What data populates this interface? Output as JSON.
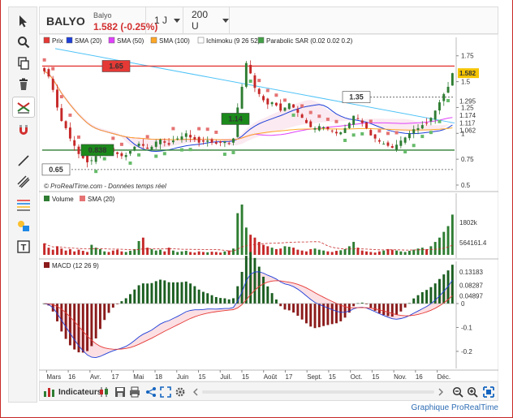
{
  "header": {
    "ticker": "BALYO",
    "company": "Balyo",
    "price_change": "1.582 (-0.25%)",
    "period": "1 J",
    "units": "200 U"
  },
  "legend": {
    "main": [
      "Prix",
      "SMA (20)",
      "SMA (50)",
      "SMA (100)",
      "Ichimoku (9 26 52)",
      "Parabolic SAR (0.02 0.02 0.2)"
    ],
    "main_colors": [
      "#e53935",
      "#1e3fd8",
      "#e040fb",
      "#ffa726",
      "#ffffff",
      "#43a047"
    ],
    "source": "© ProRealTime.com - Données temps réel",
    "volume": [
      "Volume",
      "SMA (20)"
    ],
    "macd": "MACD (12 26 9)"
  },
  "footer": {
    "link": "Graphique ProRealTime",
    "indicators": "Indicateurs"
  },
  "chart_data": [
    {
      "type": "candlestick",
      "title": "BALYO",
      "x_tick_labels": [
        "Mars",
        "16",
        "Avr.",
        "17",
        "Mai",
        "18",
        "Juin",
        "15",
        "Juil.",
        "15",
        "Août",
        "17",
        "Sept.",
        "15",
        "Oct.",
        "15",
        "Nov.",
        "16",
        "Déc."
      ],
      "y_tick_labels": [
        "1.75",
        "1.5",
        "1.25",
        "1",
        "0.75",
        "0.5"
      ],
      "ylim": [
        0.5,
        1.85
      ],
      "last_price": 1.582,
      "price_labels": [
        {
          "text": "1.65",
          "value": 1.65
        },
        {
          "text": "1.35",
          "value": 1.35
        },
        {
          "text": "1.14",
          "value": 1.14
        },
        {
          "text": "0.838",
          "value": 0.838
        },
        {
          "text": "0.65",
          "value": 0.65
        }
      ],
      "right_values": [
        {
          "text": "1.582",
          "value": 1.582,
          "color": "#f5c400"
        },
        {
          "text": "1.295",
          "value": 1.295,
          "color": "#43a047"
        },
        {
          "text": "1.174",
          "value": 1.174,
          "color": "#1e3fd8"
        },
        {
          "text": "1.117",
          "value": 1.117,
          "color": "#ffa726"
        },
        {
          "text": "1.062",
          "value": 1.062,
          "color": "#e040fb"
        }
      ],
      "close": [
        1.6,
        1.55,
        1.42,
        1.25,
        1.12,
        1.05,
        0.95,
        0.88,
        0.8,
        0.76,
        0.72,
        0.74,
        0.78,
        0.83,
        0.85,
        0.84,
        0.82,
        0.8,
        0.78,
        0.79,
        0.83,
        0.87,
        0.9,
        0.88,
        0.85,
        0.87,
        0.92,
        0.94,
        0.91,
        0.89,
        0.93,
        0.95,
        0.97,
        1.0,
        0.96,
        0.94,
        0.91,
        0.92,
        0.93,
        0.91,
        0.9,
        0.91,
        0.92,
        0.9,
        0.95,
        1.25,
        1.45,
        1.68,
        1.58,
        1.44,
        1.38,
        1.32,
        1.28,
        1.3,
        1.27,
        1.22,
        1.25,
        1.29,
        1.25,
        1.2,
        1.15,
        1.1,
        1.06,
        1.05,
        1.07,
        1.06,
        1.04,
        1.02,
        1.0,
        1.01,
        1.05,
        1.1,
        1.17,
        1.14,
        1.1,
        1.05,
        0.98,
        0.95,
        0.92,
        0.9,
        0.88,
        0.86,
        0.89,
        0.93,
        0.96,
        1.0,
        1.04,
        1.05,
        1.08,
        1.1,
        1.15,
        1.22,
        1.3,
        1.38,
        1.45,
        1.582
      ]
    },
    {
      "type": "bar",
      "title": "Volume",
      "y_tick_labels": [
        "1802k",
        "564161.4"
      ],
      "volume": [
        40,
        25,
        18,
        30,
        22,
        15,
        20,
        12,
        18,
        14,
        10,
        35,
        25,
        20,
        12,
        10,
        15,
        18,
        12,
        10,
        14,
        20,
        48,
        60,
        25,
        20,
        15,
        18,
        12,
        25,
        15,
        10,
        12,
        14,
        10,
        8,
        12,
        10,
        9,
        11,
        10,
        8,
        12,
        15,
        22,
        145,
        175,
        95,
        70,
        60,
        45,
        35,
        30,
        25,
        20,
        22,
        30,
        28,
        25,
        18,
        15,
        12,
        20,
        22,
        18,
        15,
        12,
        10,
        14,
        16,
        20,
        30,
        45,
        25,
        15,
        12,
        10,
        8,
        12,
        15,
        20,
        18,
        15,
        12,
        10,
        14,
        18,
        22,
        25,
        20,
        30,
        45,
        60,
        80,
        100,
        140
      ]
    },
    {
      "type": "bar",
      "title": "MACD (12 26 9)",
      "y_tick_labels": [
        "0.13183",
        "0.08287",
        "0.04897",
        "0",
        "-0.1",
        "-0.2"
      ],
      "ylim": [
        -0.265,
        0.17
      ],
      "last_values": {
        "macd": 0.13183,
        "signal": 0.08287,
        "histogram": 0.04897
      }
    }
  ]
}
